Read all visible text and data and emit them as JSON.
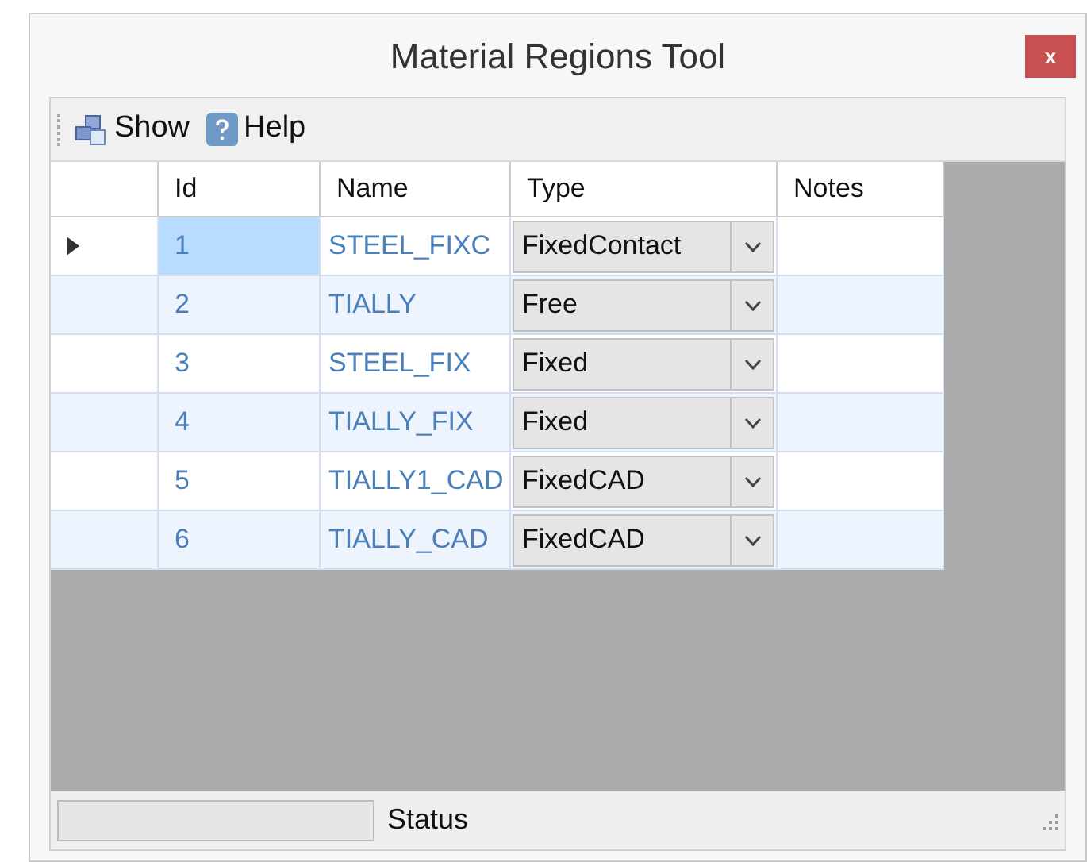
{
  "window": {
    "title": "Material Regions Tool",
    "close": "x"
  },
  "toolbar": [
    {
      "kind": "show",
      "label": "Show"
    },
    {
      "kind": "help",
      "label": "Help"
    }
  ],
  "table": {
    "columns": [
      "Id",
      "Name",
      "Type",
      "Notes"
    ],
    "rows": [
      {
        "id": "1",
        "name": "STEEL_FIXC",
        "type": "FixedContact",
        "selected": true
      },
      {
        "id": "2",
        "name": "TIALLY",
        "type": "Free",
        "selected": false
      },
      {
        "id": "3",
        "name": "STEEL_FIX",
        "type": "Fixed",
        "selected": false
      },
      {
        "id": "4",
        "name": "TIALLY_FIX",
        "type": "Fixed",
        "selected": false
      },
      {
        "id": "5",
        "name": "TIALLY1_CAD",
        "type": "FixedCAD",
        "selected": false
      },
      {
        "id": "6",
        "name": "TIALLY_CAD",
        "type": "FixedCAD",
        "selected": false
      }
    ]
  },
  "status_bar": {
    "progress": {
      "level": 0
    },
    "text": "Status"
  }
}
